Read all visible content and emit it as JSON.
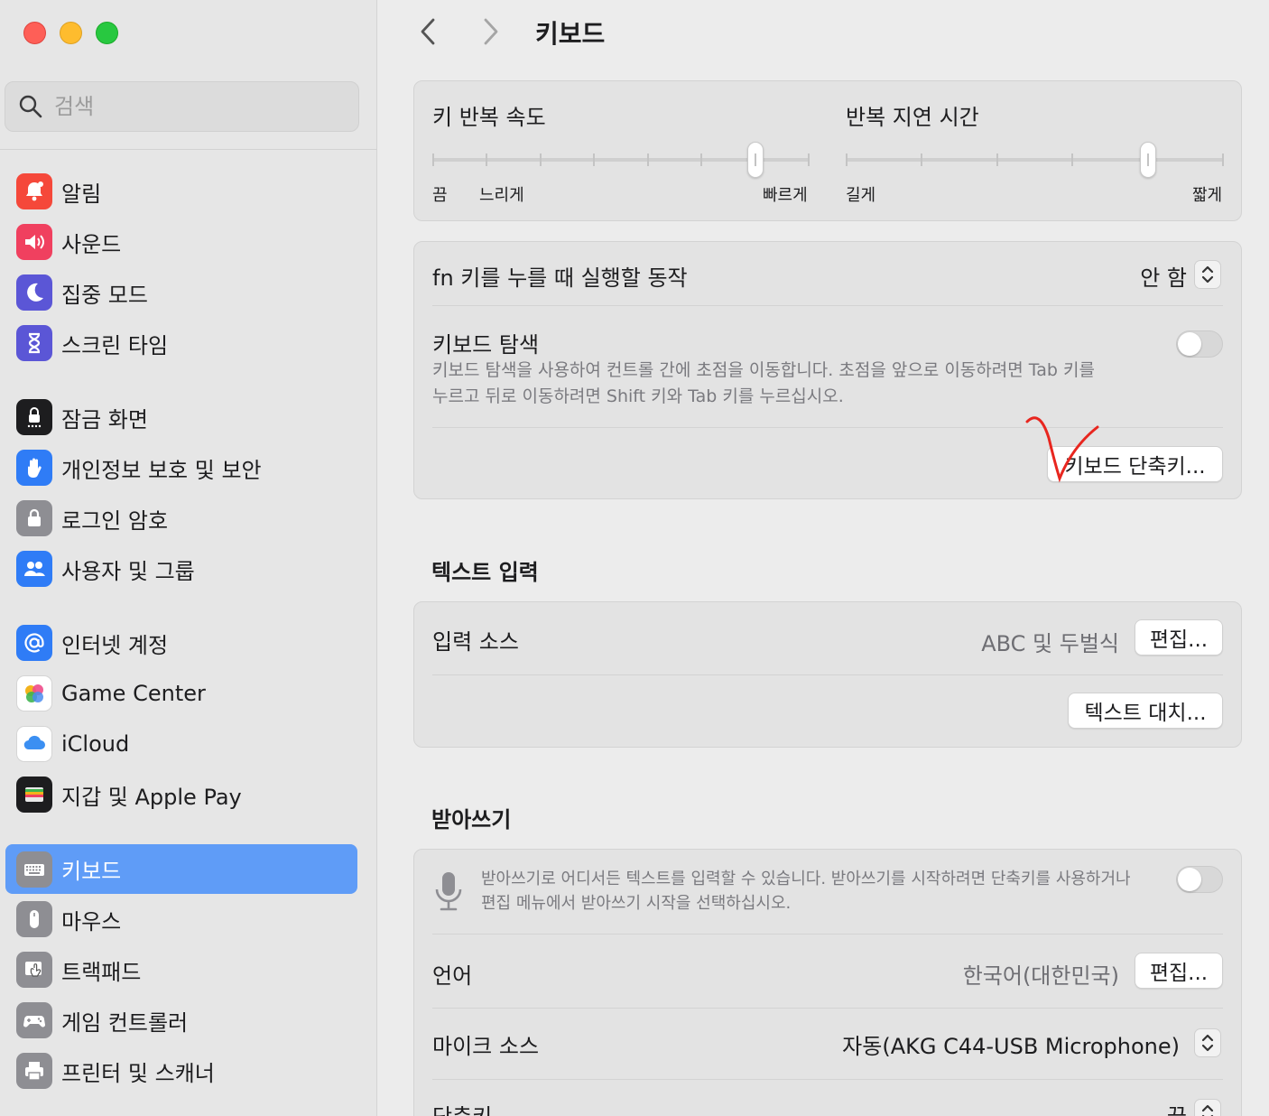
{
  "window": {
    "traffic_lights": [
      "#fe5f57",
      "#febc2e",
      "#28c840"
    ]
  },
  "search": {
    "placeholder": "검색"
  },
  "sidebar": {
    "items": [
      {
        "label": "알림",
        "icon": "bell-icon",
        "color": "#f5483a"
      },
      {
        "label": "사운드",
        "icon": "speaker-icon",
        "color": "#f0405f"
      },
      {
        "label": "집중 모드",
        "icon": "moon-icon",
        "color": "#5b56d6"
      },
      {
        "label": "스크린 타임",
        "icon": "hourglass-icon",
        "color": "#5b56d6"
      },
      {
        "label": "잠금 화면",
        "icon": "lock-screen-icon",
        "color": "#1d1d1f"
      },
      {
        "label": "개인정보 보호 및 보안",
        "icon": "hand-icon",
        "color": "#2f7cf6"
      },
      {
        "label": "로그인 암호",
        "icon": "lock-icon",
        "color": "#8e8e93"
      },
      {
        "label": "사용자 및 그룹",
        "icon": "users-icon",
        "color": "#2f7cf6"
      },
      {
        "label": "인터넷 계정",
        "icon": "at-icon",
        "color": "#2f7cf6"
      },
      {
        "label": "Game Center",
        "icon": "game-center-icon",
        "color": "#ffffff"
      },
      {
        "label": "iCloud",
        "icon": "cloud-icon",
        "color": "#ffffff"
      },
      {
        "label": "지갑 및 Apple Pay",
        "icon": "wallet-icon",
        "color": "#1d1d1f"
      },
      {
        "label": "키보드",
        "icon": "keyboard-icon",
        "color": "#8e8e93",
        "selected": true
      },
      {
        "label": "마우스",
        "icon": "mouse-icon",
        "color": "#8e8e93"
      },
      {
        "label": "트랙패드",
        "icon": "trackpad-icon",
        "color": "#8e8e93"
      },
      {
        "label": "게임 컨트롤러",
        "icon": "gamepad-icon",
        "color": "#8e8e93"
      },
      {
        "label": "프린터 및 스캐너",
        "icon": "printer-icon",
        "color": "#8e8e93"
      }
    ],
    "accent": "#5f9cf7"
  },
  "header": {
    "title": "키보드"
  },
  "key_repeat": {
    "title": "키 반복 속도",
    "labels": [
      "끔",
      "느리게",
      "빠르게"
    ],
    "value_step": 6,
    "steps": 8
  },
  "repeat_delay": {
    "title": "반복 지연 시간",
    "labels": [
      "길게",
      "짧게"
    ],
    "value_step": 4,
    "steps": 6
  },
  "fn_key": {
    "label": "fn 키를 누를 때 실행할 동작",
    "value": "안 함"
  },
  "keyboard_nav": {
    "title": "키보드 탐색",
    "description_line1": "키보드 탐색을 사용하여 컨트롤 간에 초점을 이동합니다. 초점을 앞으로 이동하려면 Tab 키를",
    "description_line2": "누르고 뒤로 이동하려면 Shift 키와 Tab 키를 누르십시오.",
    "enabled": false
  },
  "shortcuts_button": "키보드 단축키...",
  "text_input": {
    "section_title": "텍스트 입력",
    "input_source_label": "입력 소스",
    "input_source_value": "ABC 및 두벌식",
    "edit_button": "편집...",
    "replace_button": "텍스트 대치..."
  },
  "dictation": {
    "section_title": "받아쓰기",
    "description_line1": "받아쓰기로 어디서든 텍스트를 입력할 수 있습니다. 받아쓰기를 시작하려면 단축키를 사용하거나",
    "description_line2": "편집 메뉴에서 받아쓰기 시작을 선택하십시오.",
    "enabled": false,
    "language_label": "언어",
    "language_value": "한국어(대한민국)",
    "language_edit": "편집...",
    "mic_label": "마이크 소스",
    "mic_value": "자동(AKG C44-USB Microphone)",
    "shortcut_label": "단축키",
    "shortcut_value": "끔"
  },
  "annotation_color": "#e8261f"
}
